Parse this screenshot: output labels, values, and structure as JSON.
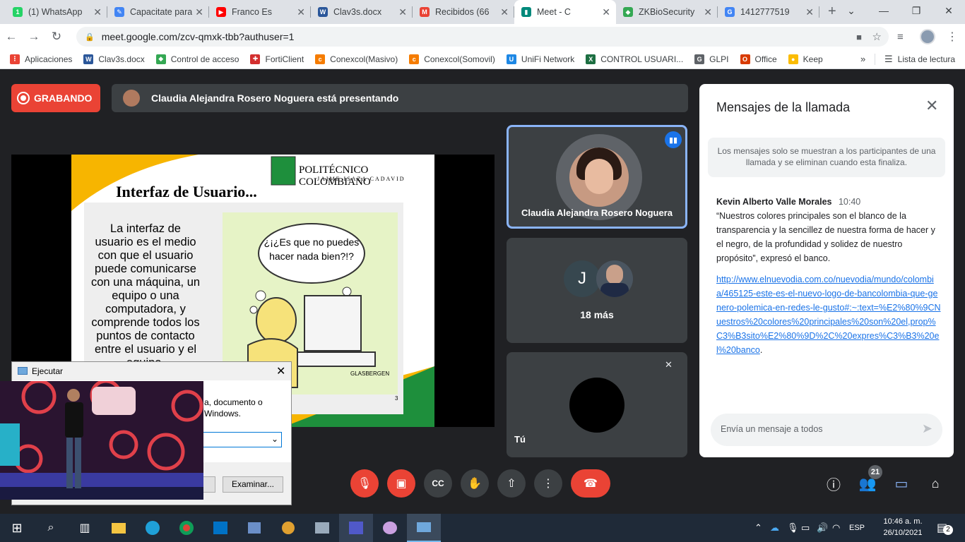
{
  "tabs": [
    {
      "label": "(1) WhatsApp",
      "color": "#25d366",
      "glyph": "1"
    },
    {
      "label": "Capacitate para",
      "color": "#4285f4",
      "glyph": "✎"
    },
    {
      "label": "Franco Es",
      "color": "#ff0000",
      "glyph": "▶"
    },
    {
      "label": "Clav3s.docx",
      "color": "#2b579a",
      "glyph": "W"
    },
    {
      "label": "Recibidos (66",
      "color": "#ea4335",
      "glyph": "M"
    },
    {
      "label": "Meet - C",
      "color": "#00897b",
      "glyph": "▮"
    },
    {
      "label": "ZKBioSecurity",
      "color": "#34a853",
      "glyph": "◆"
    },
    {
      "label": "1412777519",
      "color": "#4285f4",
      "glyph": "G"
    }
  ],
  "address": {
    "url": "meet.google.com/zcv-qmxk-tbb?authuser=1"
  },
  "bookmarks": [
    {
      "label": "Aplicaciones",
      "color": "#ea4335",
      "glyph": "⋮"
    },
    {
      "label": "Clav3s.docx",
      "color": "#2b579a",
      "glyph": "W"
    },
    {
      "label": "Control de acceso",
      "color": "#34a853",
      "glyph": "◆"
    },
    {
      "label": "FortiClient",
      "color": "#d32f2f",
      "glyph": "✚"
    },
    {
      "label": "Conexcol(Masivo)",
      "color": "#f57c00",
      "glyph": "c"
    },
    {
      "label": "Conexcol(Somovil)",
      "color": "#f57c00",
      "glyph": "c"
    },
    {
      "label": "UniFi Network",
      "color": "#1e88e5",
      "glyph": "U"
    },
    {
      "label": "CONTROL USUARI...",
      "color": "#1d6f42",
      "glyph": "X"
    },
    {
      "label": "GLPI",
      "color": "#5f6368",
      "glyph": "G"
    },
    {
      "label": "Office",
      "color": "#d83b01",
      "glyph": "O"
    },
    {
      "label": "Keep",
      "color": "#fbbc04",
      "glyph": "●"
    }
  ],
  "bookmarks_more": "»",
  "reading_list": "Lista de lectura",
  "meet": {
    "recording_label": "GRABANDO",
    "presenting_text": "Claudia Alejandra Rosero Noguera está presentando",
    "slide": {
      "title": "Interfaz de Usuario...",
      "logo_name": "POLITÉCNICO COLOMBIANO",
      "logo_sub": "JAIME ISAZA CADAVID",
      "body": "La interfaz de usuario es el medio con que el usuario puede comunicarse con una máquina, un equipo o una computadora, y comprende todos los puntos de contacto entre el usuario y el equipo.",
      "cartoon_bubble": "¿¡¿Es que no puedes hacer nada bien?!?",
      "cartoon_sign": "GLASBERGEN",
      "page_number": "3"
    },
    "tiles": {
      "presenter_name": "Claudia Alejandra Rosero Noguera",
      "group_initial": "J",
      "group_more": "18 más",
      "self_label": "Tú"
    },
    "chat": {
      "title": "Mensajes de la llamada",
      "notice": "Los mensajes solo se muestran a los participantes de una llamada y se eliminan cuando esta finaliza.",
      "sender": "Kevin Alberto Valle Morales",
      "time": "10:40",
      "message": "“Nuestros colores principales son el blanco de la transparencia y la sencillez de nuestra forma de hacer y el negro, de la profundidad y solidez de nuestro propósito”, expresó el banco.",
      "link": "http://www.elnuevodia.com.co/nuevodia/mundo/colombia/465125-este-es-el-nuevo-logo-de-bancolombia-que-genero-polemica-en-redes-le-gusto#:~:text=%E2%80%9CNuestros%20colores%20principales%20son%20el,prop%C3%B3sito%E2%80%9D%2C%20expres%C3%B3%20el%20banco",
      "link_suffix": ".",
      "input_placeholder": "Envía un mensaje a todos"
    },
    "participants_count": "21"
  },
  "run_dialog": {
    "title": "Ejecutar",
    "desc_line1": "a, documento o",
    "desc_line2": "Windows.",
    "browse_button": "Examinar..."
  },
  "taskbar": {
    "lang": "ESP",
    "time": "10:46 a. m.",
    "date": "26/10/2021",
    "notif_count": "2"
  }
}
